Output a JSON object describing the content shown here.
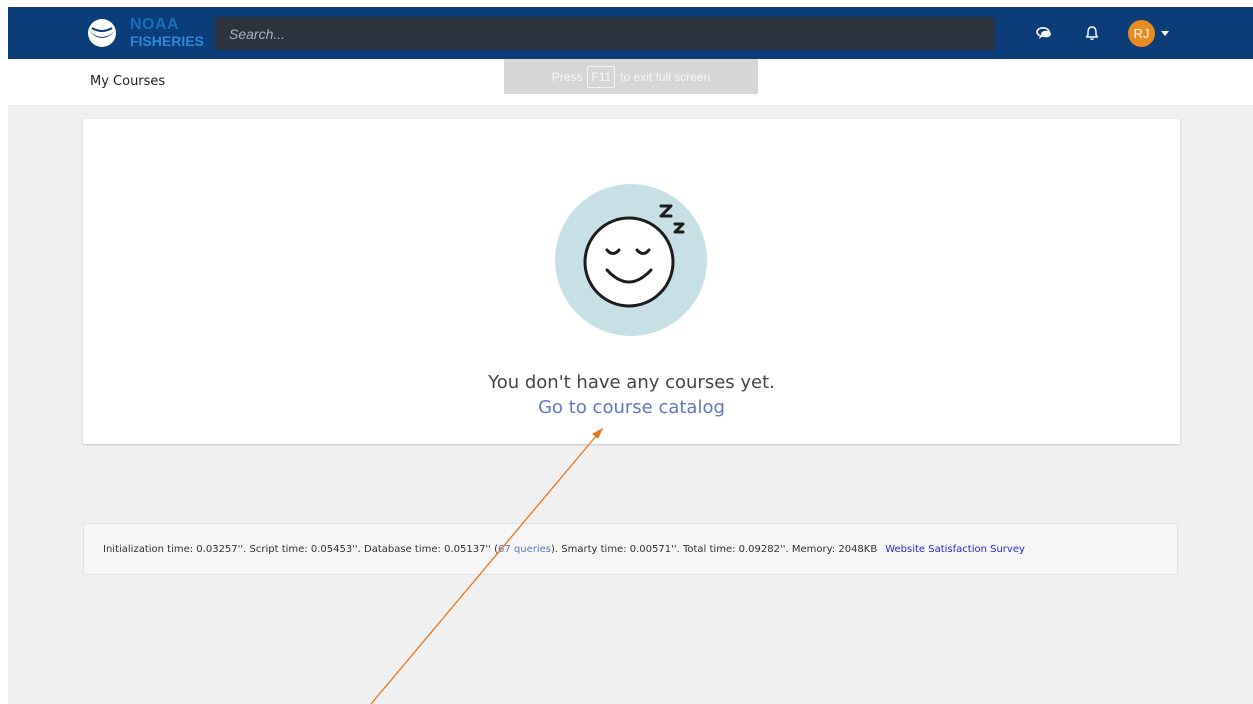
{
  "header": {
    "logo": {
      "line1": "NOAA",
      "line2": "FISHERIES"
    },
    "search": {
      "placeholder": "Search...",
      "value": ""
    },
    "icons": [
      "chat-icon",
      "bell-icon"
    ],
    "user": {
      "initials": "RJ"
    }
  },
  "subheader": {
    "title": "My Courses"
  },
  "fullscreen_banner": {
    "press": "Press",
    "key": "F11",
    "suffix": "to exit full screen"
  },
  "main": {
    "empty_message": "You don't have any courses yet.",
    "catalog_link": "Go to course catalog"
  },
  "footer": {
    "stats_prefix": "Initialization time: 0.03257''. Script time: 0.05453''. Database time: 0.05137'' (",
    "queries_link": "67 queries",
    "stats_suffix": "). Smarty time: 0.00571''. Total time: 0.09282''. Memory: 2048KB",
    "survey_link": "Website Satisfaction Survey"
  },
  "colors": {
    "nav_background": "#0b3d78",
    "accent_link": "#5f78b8",
    "avatar": "#e98b1f",
    "annotation_arrow": "#e8761c"
  }
}
